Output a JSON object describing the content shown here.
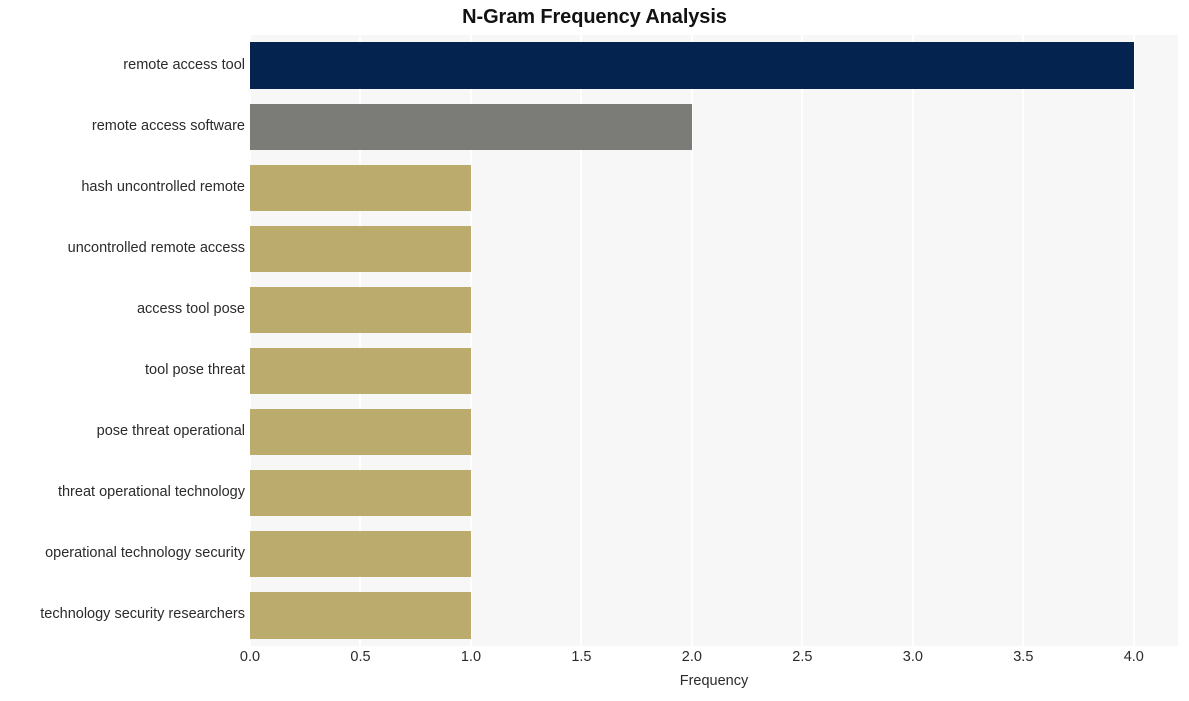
{
  "chart_data": {
    "type": "bar",
    "orientation": "horizontal",
    "title": "N-Gram Frequency Analysis",
    "xlabel": "Frequency",
    "ylabel": "",
    "xlim": [
      0.0,
      4.2
    ],
    "xticks": [
      "0.0",
      "0.5",
      "1.0",
      "1.5",
      "2.0",
      "2.5",
      "3.0",
      "3.5",
      "4.0"
    ],
    "xtick_values": [
      0.0,
      0.5,
      1.0,
      1.5,
      2.0,
      2.5,
      3.0,
      3.5,
      4.0
    ],
    "grid": "vertical-white",
    "legend": "none",
    "categories": [
      "remote access tool",
      "remote access software",
      "hash uncontrolled remote",
      "uncontrolled remote access",
      "access tool pose",
      "tool pose threat",
      "pose threat operational",
      "threat operational technology",
      "operational technology security",
      "technology security researchers"
    ],
    "values": [
      4,
      2,
      1,
      1,
      1,
      1,
      1,
      1,
      1,
      1
    ],
    "bar_colors": [
      "#04234f",
      "#7b7b78",
      "#bbac6e",
      "#bbac6e",
      "#bbac6e",
      "#bbac6e",
      "#bbac6e",
      "#bbac6e",
      "#bbac6e",
      "#bbac6e"
    ],
    "plot_background": "#f7f7f7",
    "figure_background": "#ffffff",
    "gridline_color": "#ffffff",
    "text_color": "#2b2b2b",
    "title_color": "#121212"
  }
}
